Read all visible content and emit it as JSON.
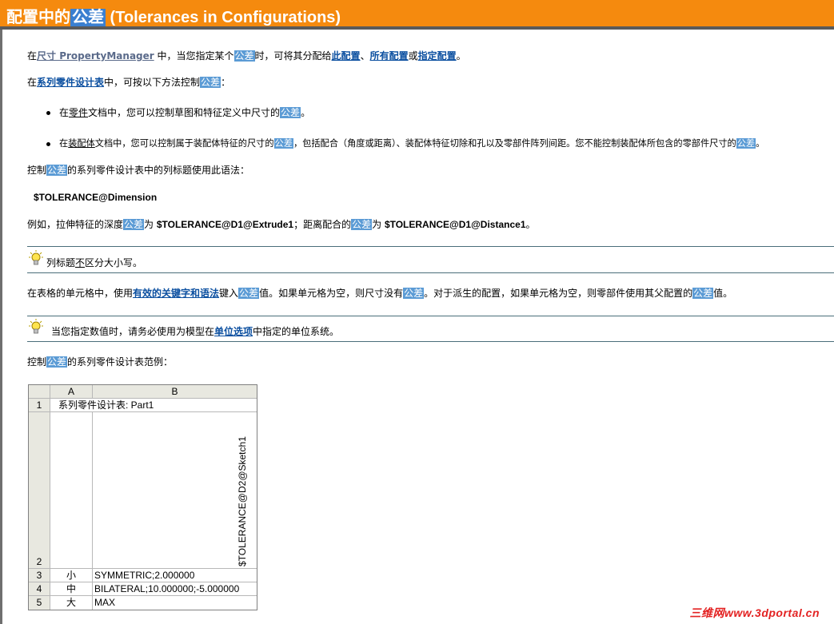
{
  "header": {
    "title_prefix": "配置中的",
    "title_highlight": "公差",
    "title_suffix": " (Tolerances in Configurations)"
  },
  "para1": {
    "t1": "在",
    "link_dim": "尺寸 PropertyManager",
    "t2": " 中，当您指定某个",
    "hl": "公差",
    "t3": "时，可将其分配给",
    "link_this": "此配置",
    "sep": "、",
    "link_all": "所有配置",
    "or": "或",
    "link_spec": "指定配置",
    "end": "。"
  },
  "para2": {
    "t1": "在",
    "link": "系列零件设计表",
    "t2": "中，可按以下方法控制",
    "hl": "公差",
    "end": "："
  },
  "bullet1": {
    "t1": "在",
    "u": "零件",
    "t2": "文档中，您可以控制草图和特征定义中尺寸的",
    "hl": "公差",
    "end": "。"
  },
  "bullet2": {
    "t1": "在",
    "u": "装配体",
    "t2": "文档中，您可以控制属于装配体特征的尺寸的",
    "hl": "公差",
    "t3": "，包括配合（角度或距离）、装配体特征切除和孔以及零部件阵列间距。您不能控制装配体所包含的零部件尺寸的",
    "hl2": "公差",
    "end": "。"
  },
  "para3": {
    "t1": "控制",
    "hl": "公差",
    "t2": "的系列零件设计表中的列标题使用此语法："
  },
  "syntax": "$TOLERANCE@Dimension",
  "para4": {
    "t1": "例如，拉伸特征的深度",
    "hl": "公差",
    "t2": "为 ",
    "code1": "$TOLERANCE@D1@Extrude1",
    "t3": "；距离配合的",
    "hl2": "公差",
    "t4": "为 ",
    "code2": "$TOLERANCE@D1@Distance1",
    "end": "。"
  },
  "tip1": {
    "t1": "列标题",
    "u": "不",
    "t2": "区分大小写。"
  },
  "para5": {
    "t1": "在表格的单元格中，使用",
    "link": "有效的关键字和语法",
    "t2": "键入",
    "hl": "公差",
    "t3": "值。如果单元格为空，则尺寸没有",
    "hl2": "公差",
    "t4": "。对于派生的配置，如果单元格为空，则零部件使用其父配置的",
    "hl3": "公差",
    "end": "值。"
  },
  "tip2": {
    "t1": "当您指定数值时，请务必使用为模型在",
    "link": "单位选项",
    "t2": "中指定的单位系统。"
  },
  "para6": {
    "t1": "控制",
    "hl": "公差",
    "t2": "的系列零件设计表范例："
  },
  "sheet": {
    "col_a": "A",
    "col_b": "B",
    "rows": [
      "1",
      "2",
      "3",
      "4",
      "5"
    ],
    "b1": "系列零件设计表: Part1",
    "b2_vertical": "$TOLERANCE@D2@Sketch1",
    "a3": "小",
    "a4": "中",
    "a5": "大",
    "b3": "SYMMETRIC;2.000000",
    "b4": "BILATERAL;10.000000;-5.000000",
    "b5": "MAX"
  },
  "watermark": "三维网www.3dportal.cn",
  "colors": {
    "title_bar": "#f58a0e",
    "highlight": "#5b9bd5",
    "link": "#0b4fa0",
    "watermark": "#e32222"
  },
  "icons": [
    "lightbulb-tip-icon"
  ]
}
